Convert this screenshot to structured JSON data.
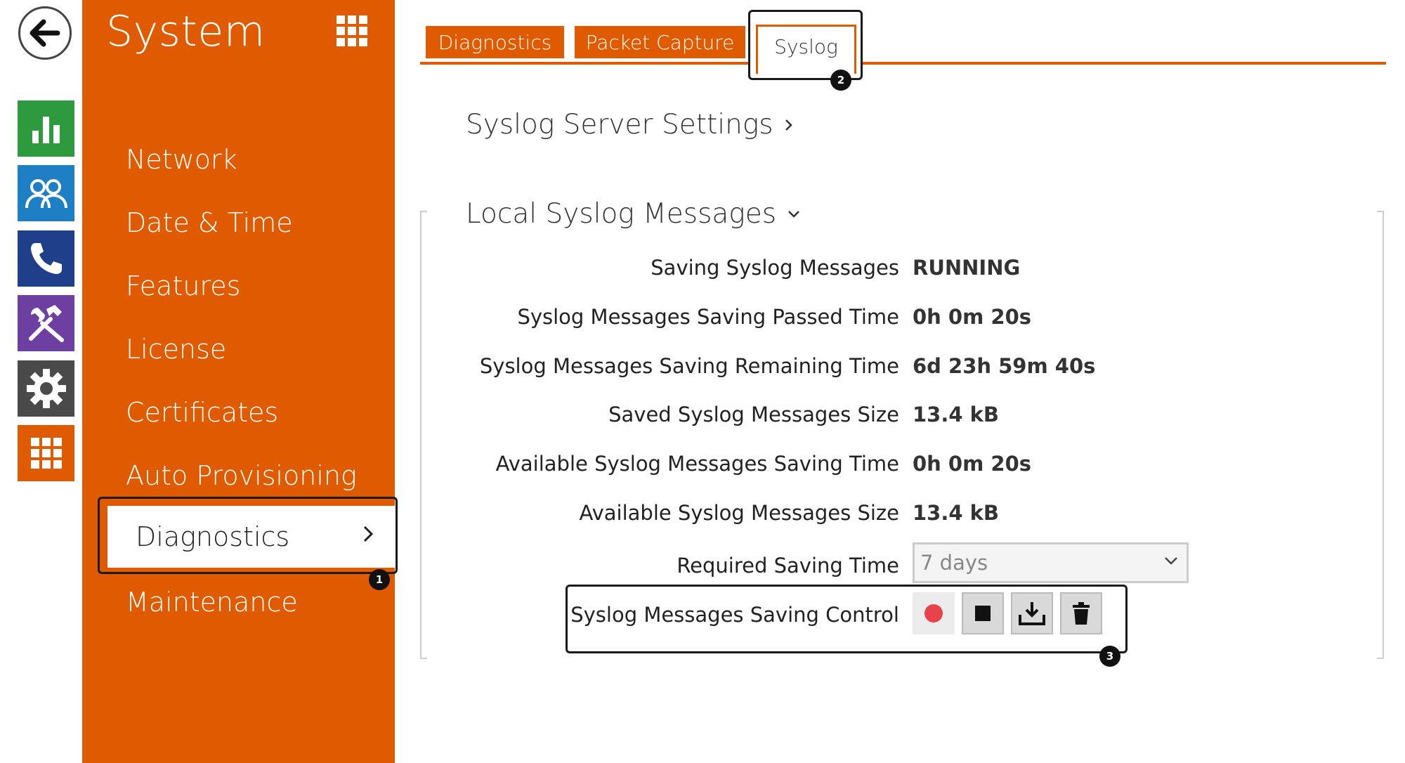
{
  "rail": {
    "icons": [
      "back-icon",
      "statistics-icon",
      "users-icon",
      "phone-icon",
      "tools-icon",
      "settings-icon",
      "apps-grid-icon"
    ],
    "colors": {
      "statistics": "#2e9a3e",
      "users": "#1f7fc4",
      "phone": "#1f3f8a",
      "tools": "#6d3fa0",
      "settings": "#4a4a4a",
      "apps": "#e05a00"
    }
  },
  "sidebar": {
    "title": "System",
    "items": [
      {
        "label": "Network"
      },
      {
        "label": "Date & Time"
      },
      {
        "label": "Features"
      },
      {
        "label": "License"
      },
      {
        "label": "Certificates"
      },
      {
        "label": "Auto Provisioning"
      },
      {
        "label": "Diagnostics",
        "active": true
      },
      {
        "label": "Maintenance"
      }
    ],
    "badge": "1"
  },
  "tabs": {
    "items": [
      {
        "label": "Diagnostics"
      },
      {
        "label": "Packet Capture"
      },
      {
        "label": "Syslog",
        "active": true
      }
    ],
    "badge": "2"
  },
  "main": {
    "server_settings_title": "Syslog Server Settings",
    "local_title": "Local Syslog Messages",
    "rows": [
      {
        "label": "Saving Syslog Messages",
        "value": "RUNNING"
      },
      {
        "label": "Syslog Messages Saving Passed Time",
        "value": "0h 0m 20s"
      },
      {
        "label": "Syslog Messages Saving Remaining Time",
        "value": "6d 23h 59m 40s"
      },
      {
        "label": "Saved Syslog Messages Size",
        "value": "13.4 kB"
      },
      {
        "label": "Available Syslog Messages Saving Time",
        "value": "0h 0m 20s"
      },
      {
        "label": "Available Syslog Messages Size",
        "value": "13.4 kB"
      }
    ],
    "required_saving_time": {
      "label": "Required Saving Time",
      "value": "7 days"
    },
    "control": {
      "label": "Syslog Messages Saving Control",
      "badge": "3"
    }
  },
  "colors": {
    "accent": "#e05a00",
    "record": "#e8434a"
  }
}
